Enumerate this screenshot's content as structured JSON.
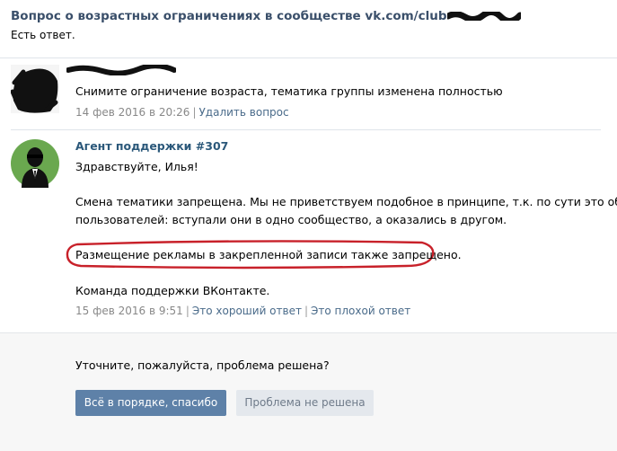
{
  "header": {
    "title": "Вопрос о возрастных ограничениях в сообществе vk.com/club",
    "status": "Есть ответ."
  },
  "user_message": {
    "text": "Снимите ограничение возраста, тематика группы изменена полностью",
    "date": "14 фев 2016 в 20:26",
    "delete_link": "Удалить вопрос"
  },
  "agent_message": {
    "author": "Агент поддержки #307",
    "greeting": "Здравствуйте, Илья!",
    "paragraph_line1": "Смена тематики запрещена. Мы не приветствуем подобное в принципе, т.к. по сути это обман",
    "paragraph_line2": "пользователей: вступали они в одно сообщество, а оказались в другом.",
    "highlighted": "Размещение рекламы в закрепленной записи также запрещено.",
    "signature": "Команда поддержки ВКонтакте.",
    "date": "15 фев 2016 в 9:51",
    "good_link": "Это хороший ответ",
    "bad_link": "Это плохой ответ"
  },
  "footer": {
    "question": "Уточните, пожалуйста, проблема решена?",
    "resolved_button": "Всё в порядке, спасибо",
    "unresolved_button": "Проблема не решена"
  },
  "colors": {
    "title": "#3a4f6a",
    "link": "#4a6b8a",
    "primary_button": "#5e81a8",
    "highlight_ring": "#c8212a",
    "agent_avatar": "#6aa84f"
  }
}
